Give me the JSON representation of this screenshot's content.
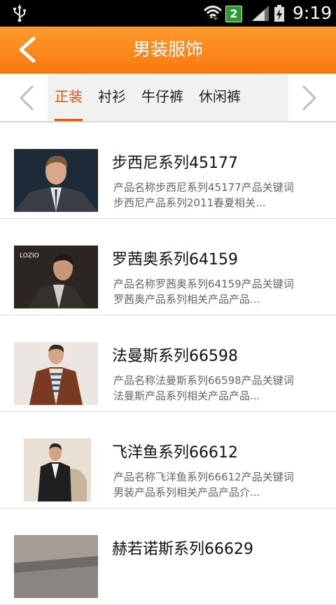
{
  "status_bar": {
    "clock": "9:19",
    "notification_count": "2",
    "icons": [
      "usb-icon",
      "wifi-icon",
      "notification-badge",
      "signal-icon",
      "battery-charging-icon"
    ]
  },
  "header": {
    "title": "男装服饰",
    "back_icon": "chevron-left-icon",
    "background": "#f7841a"
  },
  "tabs": {
    "items": [
      {
        "label": "正装",
        "active": true
      },
      {
        "label": "衬衫",
        "active": false
      },
      {
        "label": "牛仔裤",
        "active": false
      },
      {
        "label": "休闲裤",
        "active": false
      }
    ],
    "accent": "#e0560c",
    "prev_icon": "chevron-left-icon",
    "next_icon": "chevron-right-icon"
  },
  "products": [
    {
      "name": "步西尼系列45177",
      "desc_line1": "产品名称步西尼系列45177产品关键词",
      "desc_line2": "步西尼产品系列2011春夏相关..."
    },
    {
      "name": "罗茜奥系列64159",
      "desc_line1": "产品名称罗茜奥系列64159产品关键词",
      "desc_line2": "罗茜奥产品系列相关产品产品...",
      "thumb_logo": "LOZIO"
    },
    {
      "name": "法曼斯系列66598",
      "desc_line1": "产品名称法曼斯系列66598产品关键词",
      "desc_line2": "法曼斯产品系列相关产品产品..."
    },
    {
      "name": "飞洋鱼系列66612",
      "desc_line1": "产品名称飞洋鱼系列66612产品关键词",
      "desc_line2": "男装产品系列相关产品产品介..."
    },
    {
      "name": "赫若诺斯系列66629"
    }
  ]
}
